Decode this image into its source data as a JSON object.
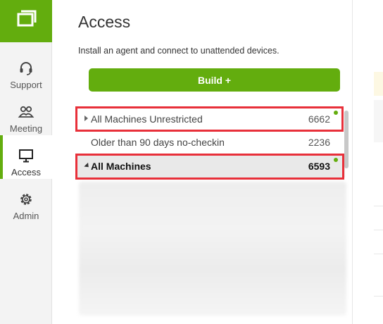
{
  "nav": {
    "items": [
      {
        "label": "Support",
        "icon": "headset-icon"
      },
      {
        "label": "Meeting",
        "icon": "people-icon"
      },
      {
        "label": "Access",
        "icon": "monitor-icon"
      },
      {
        "label": "Admin",
        "icon": "gear-icon"
      }
    ],
    "active": "Access"
  },
  "main": {
    "title": "Access",
    "subtitle": "Install an agent and connect to unattended devices.",
    "build_label": "Build +",
    "groups": [
      {
        "name": "All Machines Unrestricted",
        "count": "6662",
        "expanded": false
      },
      {
        "name": "Older than 90 days no-checkin",
        "count": "2236"
      },
      {
        "name": "All Machines",
        "count": "6593",
        "expanded": true,
        "selected": true
      }
    ]
  },
  "colors": {
    "brand_green": "#63ad0e",
    "highlight_red": "#e8303a",
    "status_dot": "#63ad0e"
  }
}
